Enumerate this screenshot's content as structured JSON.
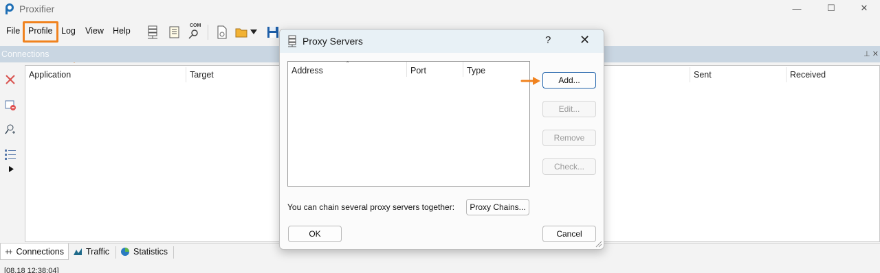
{
  "window": {
    "title": "Proxifier",
    "minimize": "—",
    "maximize": "☐",
    "close": "✕"
  },
  "menu": {
    "items": [
      "File",
      "Profile",
      "Log",
      "View",
      "Help"
    ]
  },
  "toolbar": {
    "com_label": "COM"
  },
  "connections": {
    "header": "Connections",
    "columns": [
      "Application",
      "Target",
      "Sent",
      "Received"
    ]
  },
  "tabs": {
    "items": [
      "Connections",
      "Traffic",
      "Statistics"
    ]
  },
  "log": {
    "line": "[08.18 12:38:04]"
  },
  "dialog": {
    "title": "Proxy Servers",
    "help": "?",
    "close": "✕",
    "list_columns": [
      "Address",
      "Port",
      "Type"
    ],
    "sort_indicator": "ˆ",
    "buttons": {
      "add": "Add...",
      "edit": "Edit...",
      "remove": "Remove",
      "check": "Check..."
    },
    "chain_label": "You can chain several proxy servers together:",
    "chains_button": "Proxy Chains...",
    "ok": "OK",
    "cancel": "Cancel"
  },
  "colors": {
    "highlight": "#f0821e",
    "connections_header_bg": "#c9d6e2",
    "dialog_title_bg": "#e8f1f6",
    "default_button_border": "#1b5fa8"
  }
}
